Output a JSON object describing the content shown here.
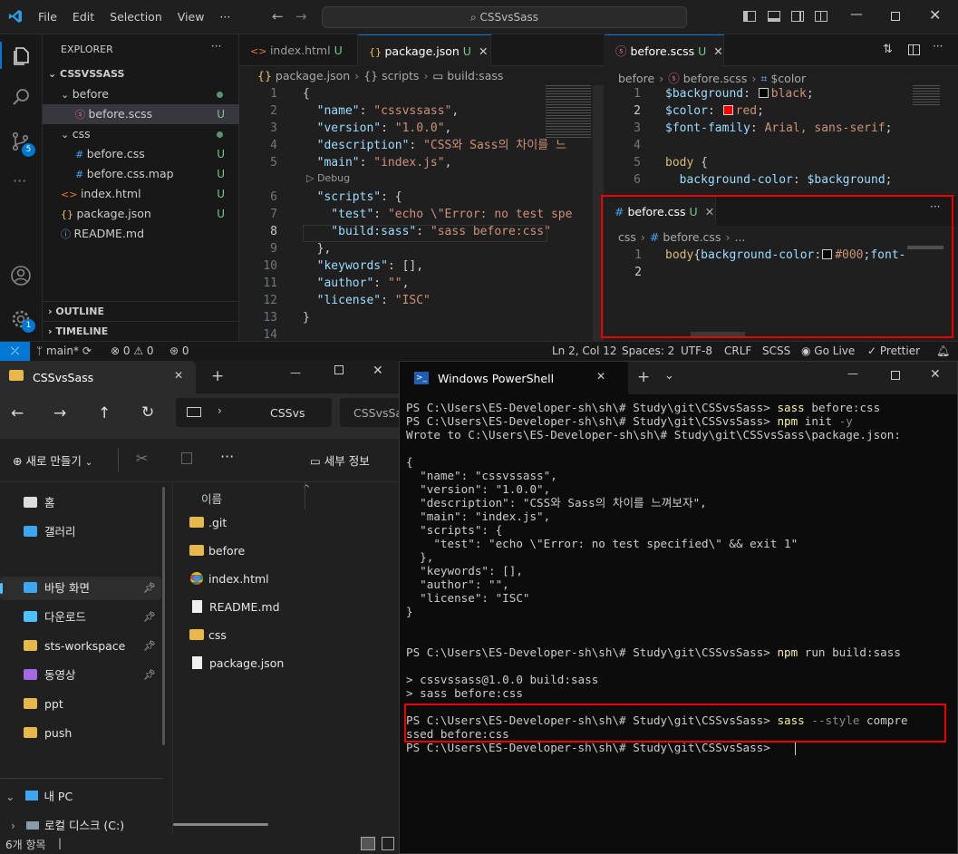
{
  "vscode": {
    "menu": [
      "File",
      "Edit",
      "Selection",
      "View",
      "···"
    ],
    "search": "CSSvsSass",
    "explorer": {
      "title": "EXPLORER",
      "root": "CSSVSSASS",
      "items": [
        {
          "name": "before",
          "kind": "folder",
          "status": "dot"
        },
        {
          "name": "before.scss",
          "kind": "scss",
          "status": "U"
        },
        {
          "name": "css",
          "kind": "folder",
          "status": "dot"
        },
        {
          "name": "before.css",
          "kind": "css",
          "status": "U"
        },
        {
          "name": "before.css.map",
          "kind": "css",
          "status": "U"
        },
        {
          "name": "index.html",
          "kind": "html",
          "status": "U"
        },
        {
          "name": "package.json",
          "kind": "json",
          "status": "U"
        },
        {
          "name": "README.md",
          "kind": "info",
          "status": ""
        }
      ],
      "outline": "OUTLINE",
      "timeline": "TIMELINE",
      "badge_scm": "5",
      "badge_settings": "1"
    },
    "tabs_left": [
      {
        "label": "index.html",
        "flag": "U"
      },
      {
        "label": "package.json",
        "flag": "U"
      }
    ],
    "breadcrumb_left": [
      "package.json",
      "{} scripts",
      "build:sass"
    ],
    "package_json_lines": [
      {
        "n": "1",
        "t": [
          {
            "c": "p",
            "v": "{"
          }
        ]
      },
      {
        "n": "2",
        "t": [
          {
            "c": "k",
            "v": "  \"name\""
          },
          {
            "c": "p",
            "v": ": "
          },
          {
            "c": "s",
            "v": "\"cssvssass\""
          },
          {
            "c": "p",
            "v": ","
          }
        ]
      },
      {
        "n": "3",
        "t": [
          {
            "c": "k",
            "v": "  \"version\""
          },
          {
            "c": "p",
            "v": ": "
          },
          {
            "c": "s",
            "v": "\"1.0.0\""
          },
          {
            "c": "p",
            "v": ","
          }
        ]
      },
      {
        "n": "4",
        "t": [
          {
            "c": "k",
            "v": "  \"description\""
          },
          {
            "c": "p",
            "v": ": "
          },
          {
            "c": "s",
            "v": "\"CSS와 Sass의 차이를 느"
          }
        ]
      },
      {
        "n": "5",
        "t": [
          {
            "c": "k",
            "v": "  \"main\""
          },
          {
            "c": "p",
            "v": ": "
          },
          {
            "c": "s",
            "v": "\"index.js\""
          },
          {
            "c": "p",
            "v": ","
          }
        ]
      },
      {
        "n": "6",
        "t": [
          {
            "c": "k",
            "v": "  \"scripts\""
          },
          {
            "c": "p",
            "v": ": {"
          }
        ]
      },
      {
        "n": "7",
        "t": [
          {
            "c": "k",
            "v": "    \"test\""
          },
          {
            "c": "p",
            "v": ": "
          },
          {
            "c": "s",
            "v": "\"echo \\\"Error: no test spe"
          }
        ]
      },
      {
        "n": "8",
        "t": [
          {
            "c": "k",
            "v": "    \"build:sass\""
          },
          {
            "c": "p",
            "v": ": "
          },
          {
            "c": "s",
            "v": "\"sass before:css\""
          }
        ]
      },
      {
        "n": "9",
        "t": [
          {
            "c": "p",
            "v": "  },"
          }
        ]
      },
      {
        "n": "10",
        "t": [
          {
            "c": "k",
            "v": "  \"keywords\""
          },
          {
            "c": "p",
            "v": ": [],"
          }
        ]
      },
      {
        "n": "11",
        "t": [
          {
            "c": "k",
            "v": "  \"author\""
          },
          {
            "c": "p",
            "v": ": "
          },
          {
            "c": "s",
            "v": "\"\""
          },
          {
            "c": "p",
            "v": ","
          }
        ]
      },
      {
        "n": "12",
        "t": [
          {
            "c": "k",
            "v": "  \"license\""
          },
          {
            "c": "p",
            "v": ": "
          },
          {
            "c": "s",
            "v": "\"ISC\""
          }
        ]
      },
      {
        "n": "13",
        "t": [
          {
            "c": "p",
            "v": "}"
          }
        ]
      },
      {
        "n": "14",
        "t": []
      }
    ],
    "debug_lens": "▷ Debug",
    "tab_right": {
      "label": "before.scss",
      "flag": "U"
    },
    "breadcrumb_right": [
      "before",
      "before.scss",
      "$color"
    ],
    "scss_lines": [
      {
        "n": "1",
        "t": [
          {
            "c": "k",
            "v": "$background"
          },
          {
            "c": "p",
            "v": ": "
          },
          {
            "c": "sw",
            "v": "#000000"
          },
          {
            "c": "s",
            "v": "black"
          },
          {
            "c": "p",
            "v": ";"
          }
        ]
      },
      {
        "n": "2",
        "t": [
          {
            "c": "k",
            "v": "$color"
          },
          {
            "c": "p",
            "v": ": "
          },
          {
            "c": "sw",
            "v": "#ff0000"
          },
          {
            "c": "s",
            "v": "red"
          },
          {
            "c": "p",
            "v": ";"
          }
        ]
      },
      {
        "n": "3",
        "t": [
          {
            "c": "k",
            "v": "$font-family"
          },
          {
            "c": "p",
            "v": ": "
          },
          {
            "c": "s",
            "v": "Arial, sans-serif"
          },
          {
            "c": "p",
            "v": ";"
          }
        ]
      },
      {
        "n": "4",
        "t": []
      },
      {
        "n": "5",
        "t": [
          {
            "c": "y",
            "v": "body"
          },
          {
            "c": "p",
            "v": " {"
          }
        ]
      },
      {
        "n": "6",
        "t": [
          {
            "c": "k",
            "v": "  background-color"
          },
          {
            "c": "p",
            "v": ": "
          },
          {
            "c": "k",
            "v": "$background"
          },
          {
            "c": "p",
            "v": ";"
          }
        ]
      }
    ],
    "css_panel": {
      "tab": {
        "label": "before.css",
        "flag": "U"
      },
      "breadcrumb": [
        "css",
        "before.css",
        "..."
      ],
      "lines": [
        {
          "n": "1",
          "t": [
            {
              "c": "y",
              "v": "body"
            },
            {
              "c": "p",
              "v": "{"
            },
            {
              "c": "k",
              "v": "background-color"
            },
            {
              "c": "p",
              "v": ":"
            },
            {
              "c": "sw",
              "v": "#000000"
            },
            {
              "c": "s",
              "v": "#000"
            },
            {
              "c": "p",
              "v": ";"
            },
            {
              "c": "k",
              "v": "font-"
            }
          ]
        },
        {
          "n": "2",
          "t": []
        }
      ]
    },
    "status": {
      "branch": "main*",
      "errors": "0",
      "warnings": "0",
      "ports": "0",
      "position": "Ln 2, Col 12",
      "spaces": "Spaces: 2",
      "encoding": "UTF-8",
      "eol": "CRLF",
      "language": "SCSS",
      "golive": "Go Live",
      "prettier": "Prettier"
    }
  },
  "file_explorer": {
    "tab": "CSSvsSass",
    "address": [
      "CSSvs",
      "CSSvsSa"
    ],
    "new_button": "새로 만들기",
    "details_button": "세부 정보",
    "column_name": "이름",
    "nav": [
      {
        "label": "홈",
        "icon": "home-icon",
        "pin": false
      },
      {
        "label": "갤러리",
        "icon": "gallery-icon",
        "pin": false
      },
      {
        "label": "바탕 화면",
        "icon": "desktop-icon",
        "pin": true
      },
      {
        "label": "다운로드",
        "icon": "download-icon",
        "pin": true
      },
      {
        "label": "sts-workspace",
        "icon": "folder-icon",
        "pin": true
      },
      {
        "label": "동영상",
        "icon": "video-icon",
        "pin": true
      },
      {
        "label": "ppt",
        "icon": "folder-icon",
        "pin": false
      },
      {
        "label": "push",
        "icon": "folder-icon",
        "pin": false
      }
    ],
    "this_pc": "내 PC",
    "local_disk": "로컬 디스크 (C:)",
    "files": [
      {
        "name": ".git",
        "icon": "folder"
      },
      {
        "name": "before",
        "icon": "folder"
      },
      {
        "name": "index.html",
        "icon": "chrome"
      },
      {
        "name": "README.md",
        "icon": "doc"
      },
      {
        "name": "css",
        "icon": "folder"
      },
      {
        "name": "package.json",
        "icon": "doc"
      }
    ],
    "item_count": "6개 항목"
  },
  "powershell": {
    "title": "Windows PowerShell",
    "lines": [
      [
        {
          "c": "w",
          "v": "PS C:\\Users\\ES-Developer-sh\\sh\\# Study\\git\\CSSvsSass> "
        },
        {
          "c": "y",
          "v": "sass"
        },
        {
          "c": "w",
          "v": " before:css"
        }
      ],
      [
        {
          "c": "w",
          "v": "PS C:\\Users\\ES-Developer-sh\\sh\\# Study\\git\\CSSvsSass> "
        },
        {
          "c": "y",
          "v": "npm"
        },
        {
          "c": "w",
          "v": " init "
        },
        {
          "c": "g",
          "v": "-y"
        }
      ],
      [
        {
          "c": "w",
          "v": "Wrote to C:\\Users\\ES-Developer-sh\\sh\\# Study\\git\\CSSvsSass\\package.json:"
        }
      ],
      [],
      [
        {
          "c": "w",
          "v": "{"
        }
      ],
      [
        {
          "c": "w",
          "v": "  \"name\": \"cssvssass\","
        }
      ],
      [
        {
          "c": "w",
          "v": "  \"version\": \"1.0.0\","
        }
      ],
      [
        {
          "c": "w",
          "v": "  \"description\": \"CSS와 Sass의 차이를 느껴보자\","
        }
      ],
      [
        {
          "c": "w",
          "v": "  \"main\": \"index.js\","
        }
      ],
      [
        {
          "c": "w",
          "v": "  \"scripts\": {"
        }
      ],
      [
        {
          "c": "w",
          "v": "    \"test\": \"echo \\\"Error: no test specified\\\" && exit 1\""
        }
      ],
      [
        {
          "c": "w",
          "v": "  },"
        }
      ],
      [
        {
          "c": "w",
          "v": "  \"keywords\": [],"
        }
      ],
      [
        {
          "c": "w",
          "v": "  \"author\": \"\","
        }
      ],
      [
        {
          "c": "w",
          "v": "  \"license\": \"ISC\""
        }
      ],
      [
        {
          "c": "w",
          "v": "}"
        }
      ],
      [],
      [],
      [
        {
          "c": "w",
          "v": "PS C:\\Users\\ES-Developer-sh\\sh\\# Study\\git\\CSSvsSass> "
        },
        {
          "c": "y",
          "v": "npm"
        },
        {
          "c": "w",
          "v": " run build:sass"
        }
      ],
      [],
      [
        {
          "c": "w",
          "v": "> cssvssass@1.0.0 build:sass"
        }
      ],
      [
        {
          "c": "w",
          "v": "> sass before:css"
        }
      ],
      [],
      [
        {
          "c": "w",
          "v": "PS C:\\Users\\ES-Developer-sh\\sh\\# Study\\git\\CSSvsSass> "
        },
        {
          "c": "y",
          "v": "sass"
        },
        {
          "c": "g",
          "v": " --style"
        },
        {
          "c": "w",
          "v": " compre"
        }
      ],
      [
        {
          "c": "w",
          "v": "ssed before:css"
        }
      ],
      [
        {
          "c": "w",
          "v": "PS C:\\Users\\ES-Developer-sh\\sh\\# Study\\git\\CSSvsSass> "
        }
      ]
    ]
  }
}
